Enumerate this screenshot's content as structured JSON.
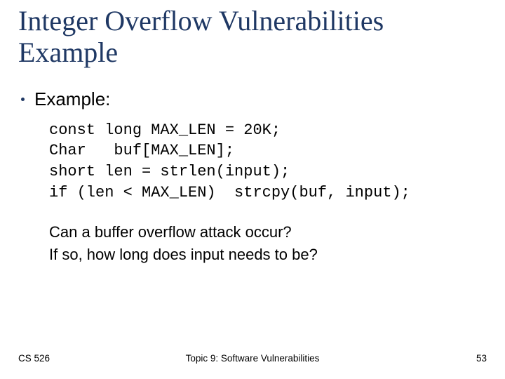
{
  "title": "Integer Overflow Vulnerabilities Example",
  "bullet": {
    "label": "Example:"
  },
  "code": {
    "line1": "const long MAX_LEN = 20K;",
    "line2": "Char   buf[MAX_LEN];",
    "line3": "short len = strlen(input);",
    "line4": "if (len < MAX_LEN)  strcpy(buf, input);"
  },
  "questions": {
    "q1": "Can a buffer overflow attack occur?",
    "q2": "If so, how long does input needs to be?"
  },
  "footer": {
    "course": "CS 526",
    "topic": "Topic 9: Software Vulnerabilities",
    "page": "53"
  }
}
